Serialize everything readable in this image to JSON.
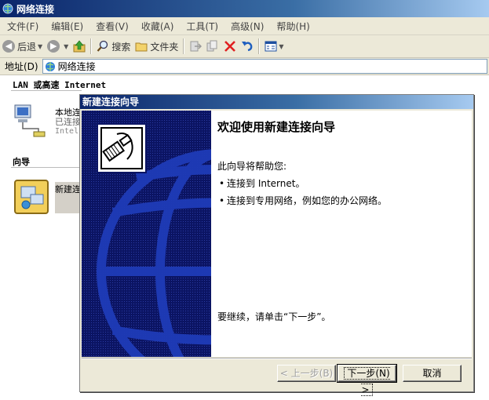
{
  "window": {
    "title": "网络连接"
  },
  "menu": [
    "文件(F)",
    "编辑(E)",
    "查看(V)",
    "收藏(A)",
    "工具(T)",
    "高级(N)",
    "帮助(H)"
  ],
  "toolbar": {
    "back": "后退",
    "search": "搜索",
    "folders": "文件夹"
  },
  "address": {
    "label": "地址(D)",
    "value": "网络连接"
  },
  "groups": {
    "lan_header": "LAN 或高速 Internet",
    "wizard_header": "向导",
    "lan_item": {
      "name": "本地连",
      "status": "已连接",
      "device": "Intel"
    },
    "wizard_item": {
      "name": "新建连"
    }
  },
  "dialog": {
    "title": "新建连接向导",
    "heading": "欢迎使用新建连接向导",
    "intro": "此向导将帮助您:",
    "bullets": [
      "连接到 Internet。",
      "连接到专用网络，例如您的办公网络。"
    ],
    "continue_text": "要继续，请单击“下一步”。",
    "buttons": {
      "back": "< 上一步(B)",
      "next": "下一步(N) >",
      "cancel": "取消"
    }
  },
  "colors": {
    "titlebar": "#0a246a",
    "wizard_panel": "#0a1866",
    "dialog_bg": "#ece9d8"
  }
}
